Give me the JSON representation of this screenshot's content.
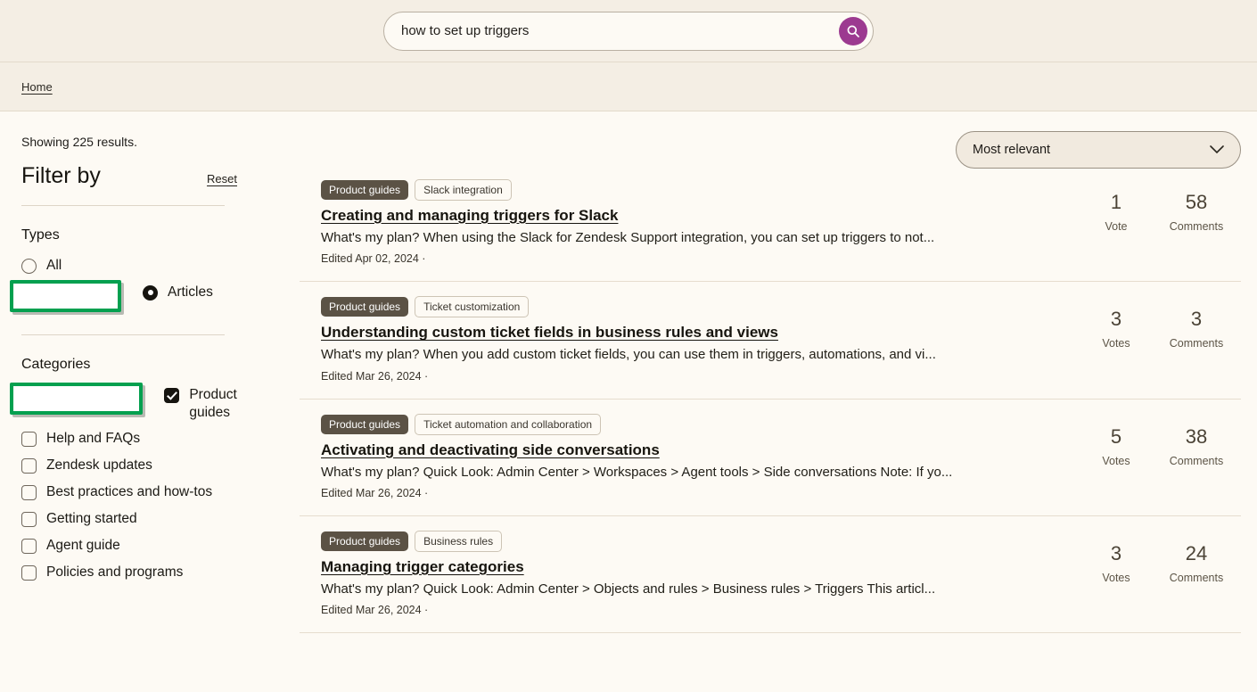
{
  "search": {
    "value": "how to set up triggers",
    "placeholder": "Search",
    "button_icon": "search-icon"
  },
  "breadcrumb": {
    "home": "Home"
  },
  "sidebar": {
    "showing": "Showing 225 results.",
    "filter_title": "Filter by",
    "reset_label": "Reset",
    "types": {
      "title": "Types",
      "options": [
        {
          "label": "All",
          "checked": false
        },
        {
          "label": "Articles",
          "checked": true,
          "highlighted": true
        }
      ]
    },
    "categories": {
      "title": "Categories",
      "options": [
        {
          "label": "Product guides",
          "checked": true,
          "highlighted": true
        },
        {
          "label": "Help and FAQs",
          "checked": false
        },
        {
          "label": "Zendesk updates",
          "checked": false
        },
        {
          "label": "Best practices and how-tos",
          "checked": false
        },
        {
          "label": "Getting started",
          "checked": false
        },
        {
          "label": "Agent guide",
          "checked": false
        },
        {
          "label": "Policies and programs",
          "checked": false
        }
      ]
    }
  },
  "main": {
    "sort": {
      "selected": "Most relevant",
      "icon": "chevron-down-icon"
    },
    "results": [
      {
        "category_badge": "Product guides",
        "topic_badge": "Slack integration",
        "title": "Creating and managing triggers for Slack",
        "snippet": "What's my plan? When using the Slack for Zendesk Support integration, you can set up triggers to not...",
        "meta": "Edited Apr 02, 2024 ·",
        "votes": "1",
        "votes_label": "Vote",
        "comments": "58",
        "comments_label": "Comments"
      },
      {
        "category_badge": "Product guides",
        "topic_badge": "Ticket customization",
        "title": "Understanding custom ticket fields in business rules and views",
        "snippet": "What's my plan? When you add custom ticket fields, you can use them in triggers, automations, and vi...",
        "meta": "Edited Mar 26, 2024 ·",
        "votes": "3",
        "votes_label": "Votes",
        "comments": "3",
        "comments_label": "Comments"
      },
      {
        "category_badge": "Product guides",
        "topic_badge": "Ticket automation and collaboration",
        "title": "Activating and deactivating side conversations",
        "snippet": "What's my plan? Quick Look: Admin Center > Workspaces > Agent tools > Side conversations Note: If yo...",
        "meta": "Edited Mar 26, 2024 ·",
        "votes": "5",
        "votes_label": "Votes",
        "comments": "38",
        "comments_label": "Comments"
      },
      {
        "category_badge": "Product guides",
        "topic_badge": "Business rules",
        "title": "Managing trigger categories",
        "snippet": "What's my plan? Quick Look: Admin Center > Objects and rules > Business rules > Triggers This articl...",
        "meta": "Edited Mar 26, 2024 ·",
        "votes": "3",
        "votes_label": "Votes",
        "comments": "24",
        "comments_label": "Comments"
      }
    ]
  },
  "colors": {
    "header_bg": "#f4eee4",
    "page_bg": "#fdfaf4",
    "search_accent": "#9c3a90",
    "badge_solid": "#5b5245",
    "highlight_green": "#04a04f"
  }
}
